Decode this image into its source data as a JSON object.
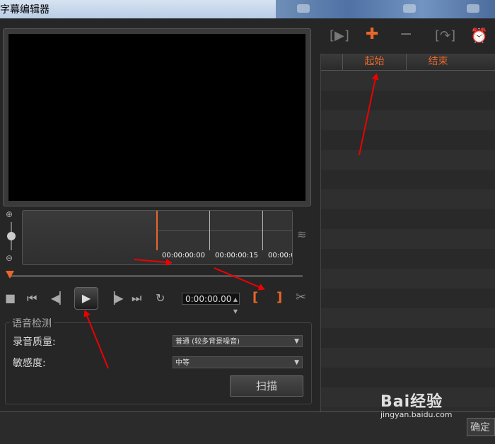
{
  "window": {
    "title": "字幕编辑器"
  },
  "timeline": {
    "timecodes": [
      "00:00:00:00",
      "00:00:00:15",
      "00:00:0"
    ]
  },
  "controls": {
    "timecode": "0:00:00.00"
  },
  "speech": {
    "legend": "语音检测",
    "quality_label": "录音质量:",
    "quality_value": "普通 (较多背景噪音)",
    "sensitivity_label": "敏感度:",
    "sensitivity_value": "中等",
    "scan_label": "扫描"
  },
  "list": {
    "col_start": "起始",
    "col_end": "结束"
  },
  "footer": {
    "ok_label": "确定"
  },
  "watermark": {
    "brand": "Bai经验",
    "url": "jingyan.baidu.com"
  },
  "colors": {
    "accent": "#e8662a",
    "annotation": "#ee0000"
  },
  "icons": [
    "stop-icon",
    "prev-icon",
    "step-back-icon",
    "play-icon",
    "step-forward-icon",
    "next-icon",
    "loop-icon",
    "mark-in-icon",
    "mark-out-icon",
    "scissors-icon",
    "add-icon",
    "remove-icon",
    "merge-icon",
    "split-icon",
    "alarm-icon",
    "waveform-icon",
    "zoom-in-icon",
    "zoom-out-icon"
  ]
}
